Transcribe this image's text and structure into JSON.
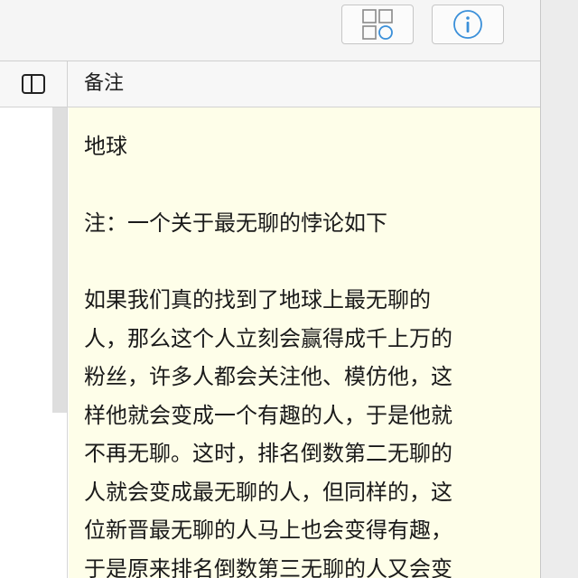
{
  "toolbar": {
    "gallery_button": {
      "icon": "gallery-view-icon",
      "color": "#888888",
      "accent": "#3a8fd9"
    },
    "info_button": {
      "icon": "info-icon",
      "color": "#3a8fd9"
    }
  },
  "table": {
    "toggle_icon": "sidebar-toggle-icon",
    "column_header": "备注"
  },
  "note": {
    "title": "地球",
    "subtitle": "注：一个关于最无聊的悖论如下",
    "lines": [
      "如果我们真的找到了地球上最无聊的",
      "人，那么这个人立刻会赢得成千上万的",
      "粉丝，许多人都会关注他、模仿他，这",
      "样他就会变成一个有趣的人，于是他就",
      "不再无聊。这时，排名倒数第二无聊的",
      "人就会变成最无聊的人，但同样的，这",
      "位新晋最无聊的人马上也会变得有趣，",
      "于是原来排名倒数第三无聊的人又会变"
    ]
  },
  "colors": {
    "note_background": "#fefee9",
    "toolbar_background": "#f5f5f5",
    "accent": "#3a8fd9"
  }
}
